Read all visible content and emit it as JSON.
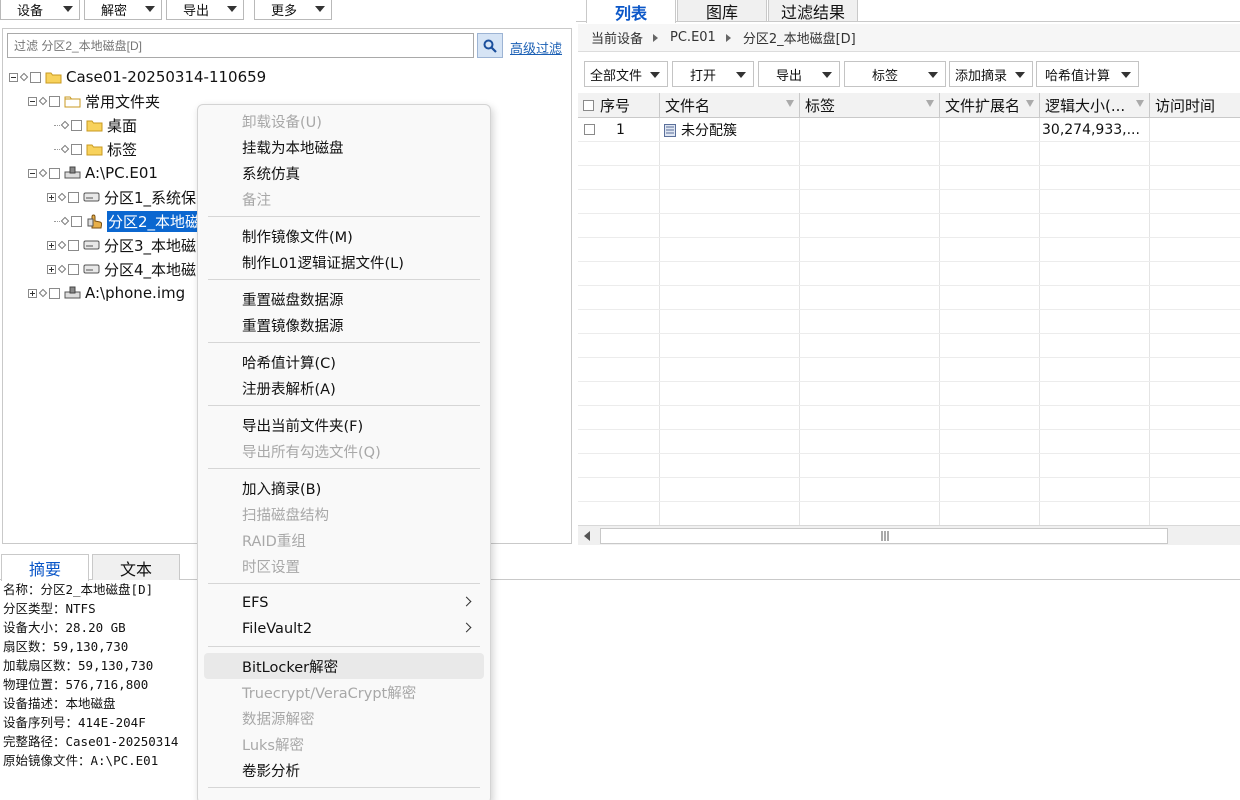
{
  "toolbar": {
    "device": "设备",
    "decrypt": "解密",
    "export": "导出",
    "more": "更多"
  },
  "filter": {
    "placeholder": "过滤 分区2_本地磁盘[D]",
    "advanced": "高级过滤"
  },
  "tree": {
    "case": "Case01-20250314-110659",
    "common_folder": "常用文件夹",
    "desktop": "桌面",
    "tags": "标签",
    "pc_image": "A:\\PC.E01",
    "part1": "分区1_系统保",
    "part2": "分区2_本地磁",
    "part3": "分区3_本地磁",
    "part4": "分区4_本地磁",
    "phone_image": "A:\\phone.img"
  },
  "bottom_tabs": {
    "summary": "摘要",
    "text": "文本"
  },
  "info": [
    "名称：分区2_本地磁盘[D]",
    "分区类型：NTFS",
    "设备大小：28.20 GB",
    "扇区数：59,130,730",
    "加载扇区数：59,130,730",
    "物理位置：576,716,800",
    "设备描述：本地磁盘",
    "设备序列号：414E-204F",
    "完整路径：Case01-20250314",
    "原始镜像文件：A:\\PC.E01"
  ],
  "right_tabs": {
    "list": "列表",
    "gallery": "图库",
    "filter_results": "过滤结果"
  },
  "breadcrumb": {
    "current_device": "当前设备",
    "device": "PC.E01",
    "partition": "分区2_本地磁盘[D]"
  },
  "right_toolbar": {
    "all_files": "全部文件",
    "open": "打开",
    "export": "导出",
    "tag": "标签",
    "add_excerpt": "添加摘录",
    "hash": "哈希值计算"
  },
  "table": {
    "columns": {
      "index": "序号",
      "filename": "文件名",
      "tag": "标签",
      "ext": "文件扩展名",
      "size": "逻辑大小(...",
      "access": "访问时间"
    },
    "rows": [
      {
        "index": "1",
        "filename": "未分配簇",
        "tag": "",
        "ext": "",
        "size": "30,274,933,...",
        "access": ""
      }
    ]
  },
  "context_menu": {
    "unmount": "卸载设备(U)",
    "mount_local": "挂载为本地磁盘",
    "system_sim": "系统仿真",
    "note": "备注",
    "make_image": "制作镜像文件(M)",
    "make_l01": "制作L01逻辑证据文件(L)",
    "reset_disk_source": "重置磁盘数据源",
    "reset_image_source": "重置镜像数据源",
    "hash_calc": "哈希值计算(C)",
    "registry": "注册表解析(A)",
    "export_folder": "导出当前文件夹(F)",
    "export_checked": "导出所有勾选文件(Q)",
    "add_excerpt": "加入摘录(B)",
    "scan_disk": "扫描磁盘结构",
    "raid": "RAID重组",
    "timezone": "时区设置",
    "efs": "EFS",
    "filevault": "FileVault2",
    "bitlocker": "BitLocker解密",
    "truecrypt": "Truecrypt/VeraCrypt解密",
    "datasource_decrypt": "数据源解密",
    "luks": "Luks解密",
    "shadow_copy": "卷影分析"
  },
  "colors": {
    "accent": "#0b57c8",
    "selection": "#0b67d0",
    "folder": "#f2c744",
    "disabled": "#a8a8a8"
  }
}
